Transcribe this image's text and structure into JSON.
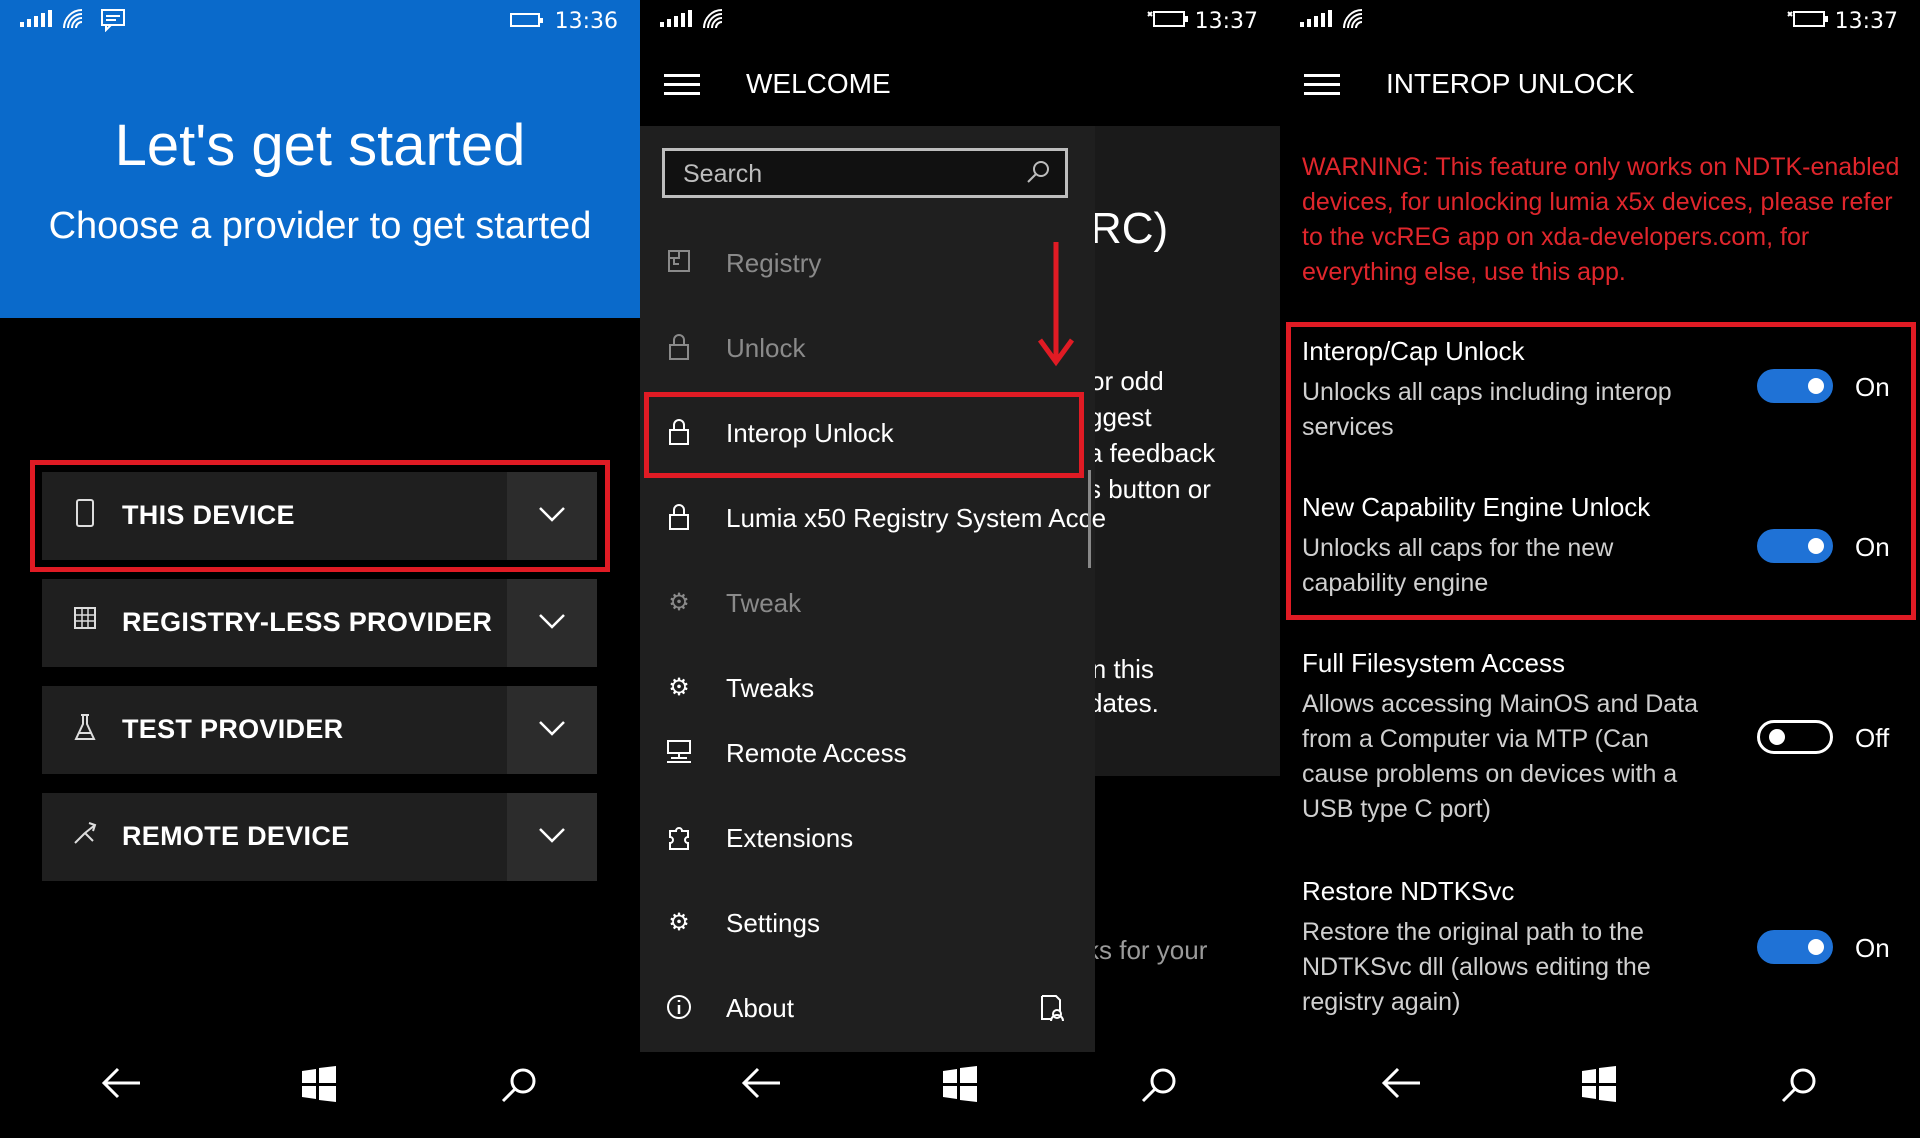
{
  "panel1": {
    "status": {
      "time": "13:36"
    },
    "hero": {
      "title": "Let's get started",
      "subtitle": "Choose a provider to get started"
    },
    "providers": [
      {
        "label": "THIS DEVICE",
        "icon": "phone-icon"
      },
      {
        "label": "REGISTRY-LESS PROVIDER",
        "icon": "grid-icon"
      },
      {
        "label": "TEST PROVIDER",
        "icon": "flask-icon"
      },
      {
        "label": "REMOTE DEVICE",
        "icon": "remote-icon"
      }
    ]
  },
  "panel2": {
    "status": {
      "time": "13:37"
    },
    "title": "WELCOME",
    "search": {
      "placeholder": "Search"
    },
    "menu": [
      {
        "label": "Registry",
        "icon": "registry-icon",
        "enabled": false
      },
      {
        "label": "Unlock",
        "icon": "lock-icon",
        "enabled": false
      },
      {
        "label": "Interop Unlock",
        "icon": "lock-icon",
        "enabled": true
      },
      {
        "label": "Lumia x50 Registry System Acce",
        "icon": "lock-icon",
        "enabled": true
      },
      {
        "label": "Tweak",
        "icon": "gear-icon",
        "enabled": false
      },
      {
        "label": "Tweaks",
        "icon": "gear-icon",
        "enabled": true
      },
      {
        "label": "Remote Access",
        "icon": "remote-pc-icon",
        "enabled": true
      },
      {
        "label": "Extensions",
        "icon": "puzzle-icon",
        "enabled": true
      },
      {
        "label": "Settings",
        "icon": "gear-icon",
        "enabled": true
      },
      {
        "label": "About",
        "icon": "info-icon",
        "enabled": true
      }
    ],
    "background_text": [
      "RC)",
      "or odd",
      "ggest",
      "a feedback",
      "s button or",
      "in this",
      "dates.",
      "ks for your"
    ]
  },
  "panel3": {
    "status": {
      "time": "13:37"
    },
    "title": "INTEROP UNLOCK",
    "warning": "WARNING: This feature only works on NDTK-enabled devices, for unlocking lumia x5x devices, please refer to the vcREG app on xda-developers.com, for everything else, use this app.",
    "settings": [
      {
        "title": "Interop/Cap Unlock",
        "desc": "Unlocks all caps including interop services",
        "state": "On"
      },
      {
        "title": "New Capability Engine Unlock",
        "desc": "Unlocks all caps for the new capability engine",
        "state": "On"
      },
      {
        "title": "Full Filesystem Access",
        "desc": "Allows accessing MainOS and Data from a Computer via MTP (Can cause problems on devices with a USB type C port)",
        "state": "Off"
      },
      {
        "title": "Restore NDTKSvc",
        "desc": "Restore the original path to the NDTKSvc dll (allows editing the registry again)",
        "state": "On"
      }
    ]
  },
  "colors": {
    "accent": "#0a6acb",
    "toggle_on": "#1f72d6",
    "highlight": "#e01b24",
    "warning": "#e0262c"
  }
}
